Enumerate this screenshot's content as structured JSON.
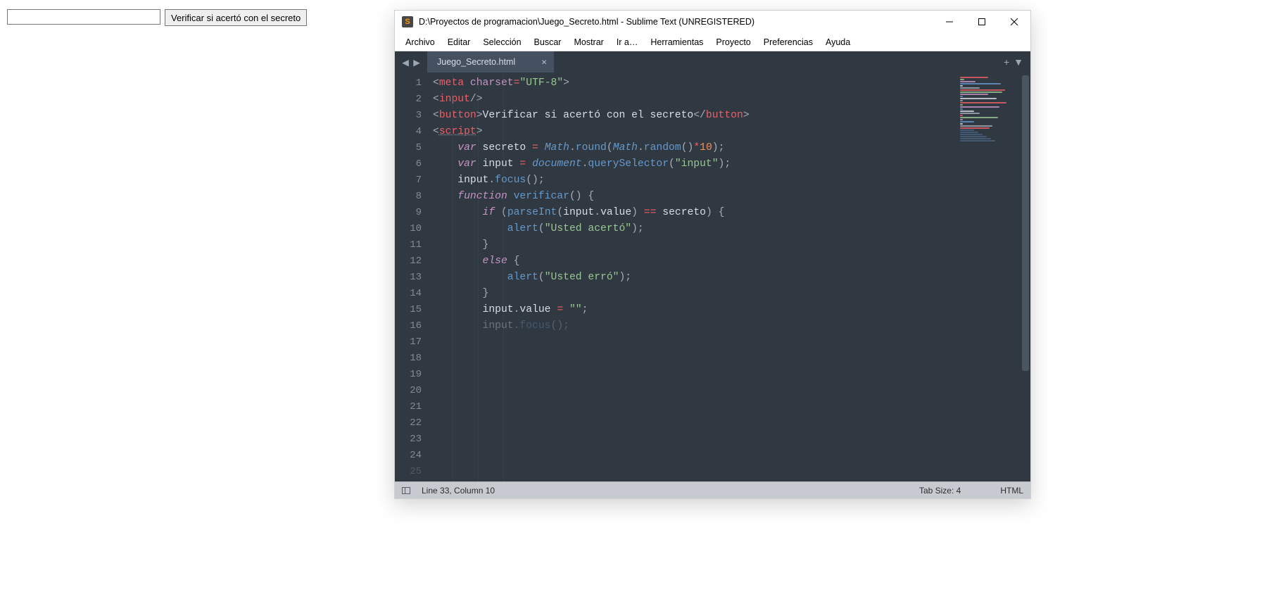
{
  "browser": {
    "input_value": "",
    "button_label": "Verificar si acertó con el secreto"
  },
  "editor": {
    "title": "D:\\Proyectos de programacion\\Juego_Secreto.html - Sublime Text (UNREGISTERED)",
    "menu": [
      "Archivo",
      "Editar",
      "Selección",
      "Buscar",
      "Mostrar",
      "Ir a…",
      "Herramientas",
      "Proyecto",
      "Preferencias",
      "Ayuda"
    ],
    "tab": {
      "name": "Juego_Secreto.html"
    },
    "status": {
      "position": "Line 33, Column 10",
      "tab_size": "Tab Size: 4",
      "syntax": "HTML"
    },
    "line_start": 1,
    "line_end": 24,
    "code_raw": "<meta charset=\"UTF-8\">\n\n<input/>\n<button>Verificar si acertó con el secreto</button>\n\n<script>\n    var secreto = Math.round(Math.random()*10);\n    var input = document.querySelector(\"input\");\n    input.focus();\n\n    function verificar() {\n\n        if (parseInt(input.value) == secreto) {\n\n            alert(\"Usted acertó\");\n\n        }\n        else {\n\n            alert(\"Usted erró\");\n\n        }\n\n        input.value = \"\";"
  }
}
